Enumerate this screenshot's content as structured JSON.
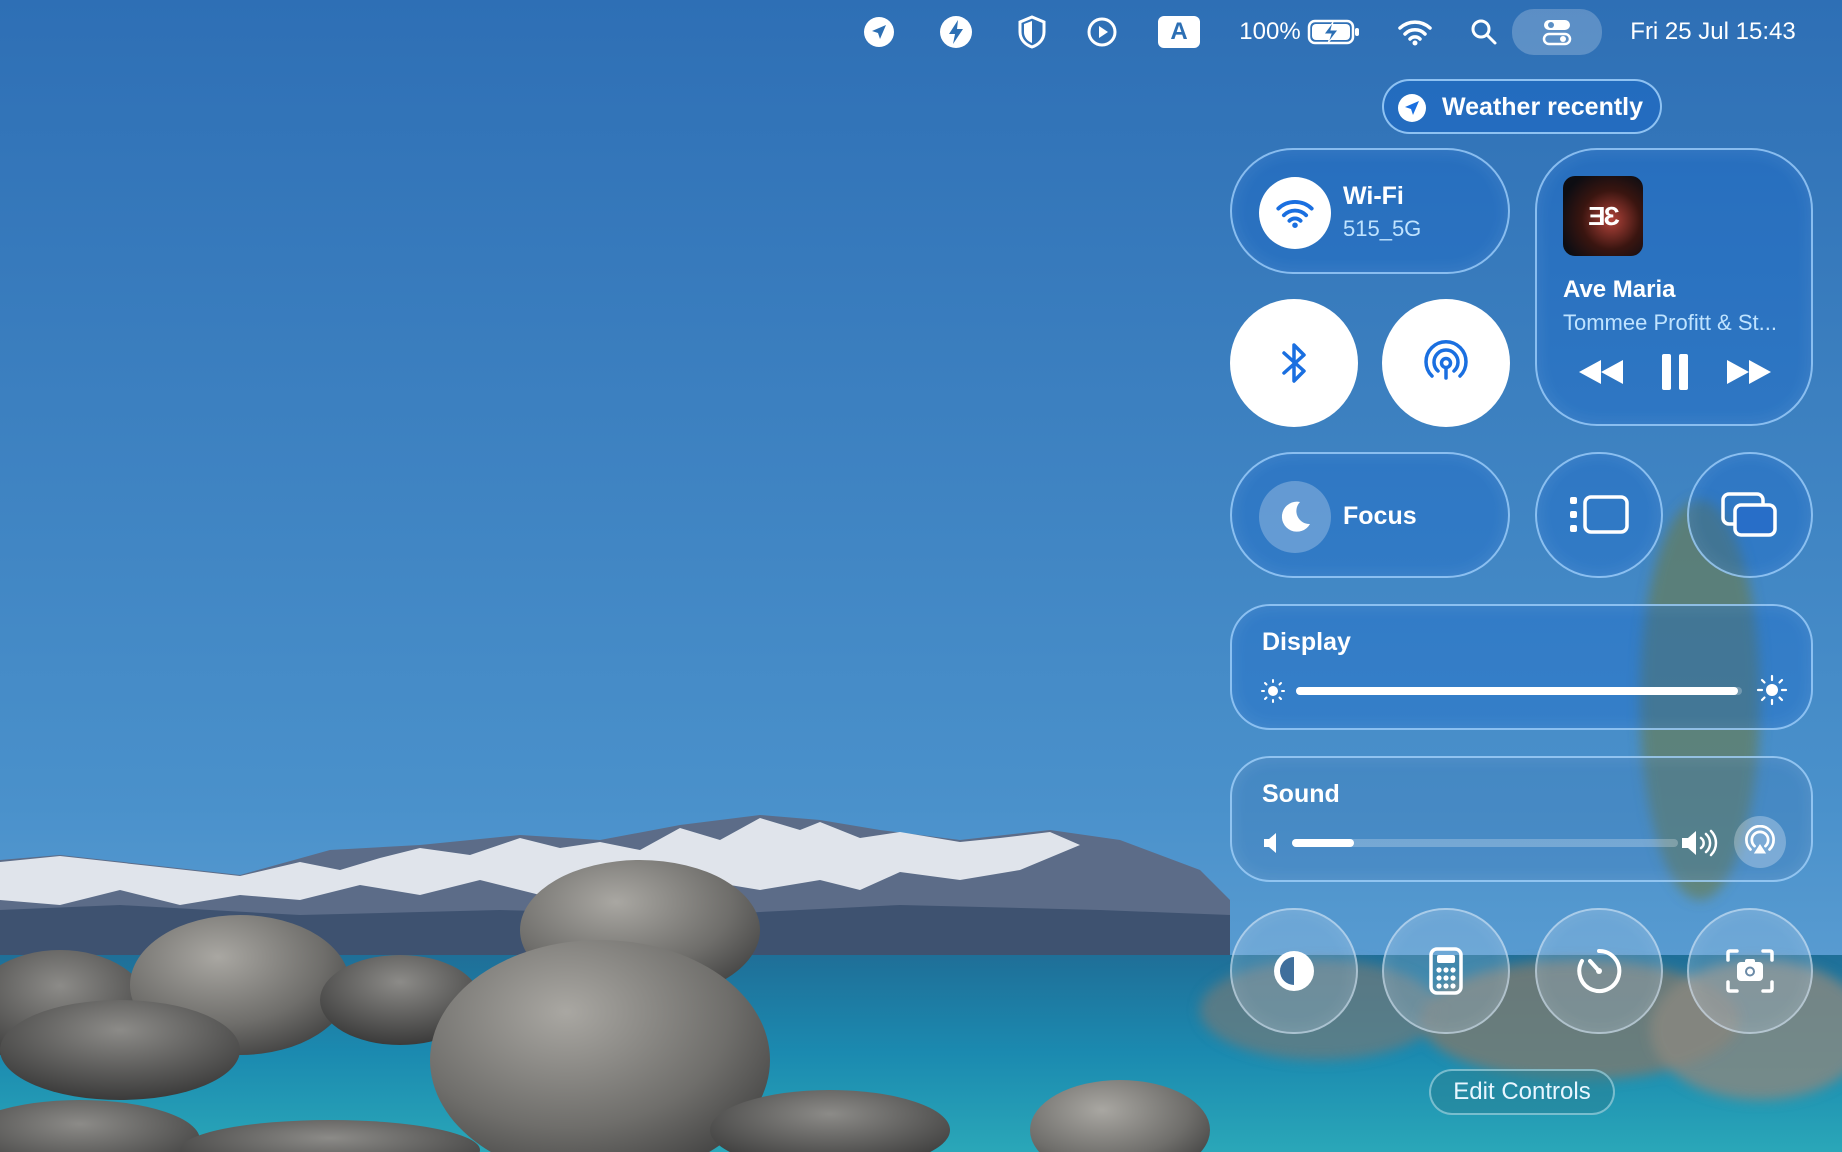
{
  "menubar": {
    "battery_percent_label": "100%",
    "battery_level": 1.0,
    "datetime": "Fri 25 Jul 15:43",
    "keyboard_input_label": "A",
    "icons": [
      "location-arrow-icon",
      "bolt-icon",
      "shield-icon",
      "play-circle-icon",
      "keyboard-input-icon",
      "battery-charging-icon",
      "wifi-icon",
      "search-icon",
      "control-center-icon"
    ]
  },
  "control_center": {
    "weather_label": "Weather recently",
    "wifi": {
      "label": "Wi-Fi",
      "network": "515_5G"
    },
    "now_playing": {
      "title": "Ave Maria",
      "artist": "Tommee Profitt & St...",
      "album_art_text": "ƎƐ"
    },
    "focus": {
      "label": "Focus"
    },
    "display": {
      "label": "Display",
      "brightness": 0.99
    },
    "sound": {
      "label": "Sound",
      "volume": 0.16
    },
    "edit_controls_label": "Edit Controls"
  },
  "colors": {
    "accent": "#1a6fe0",
    "pill_border": "#aad7ff",
    "sky_top": "#2f73b8",
    "sky_bottom": "#4a92cc",
    "water": "#1c7ea8"
  }
}
